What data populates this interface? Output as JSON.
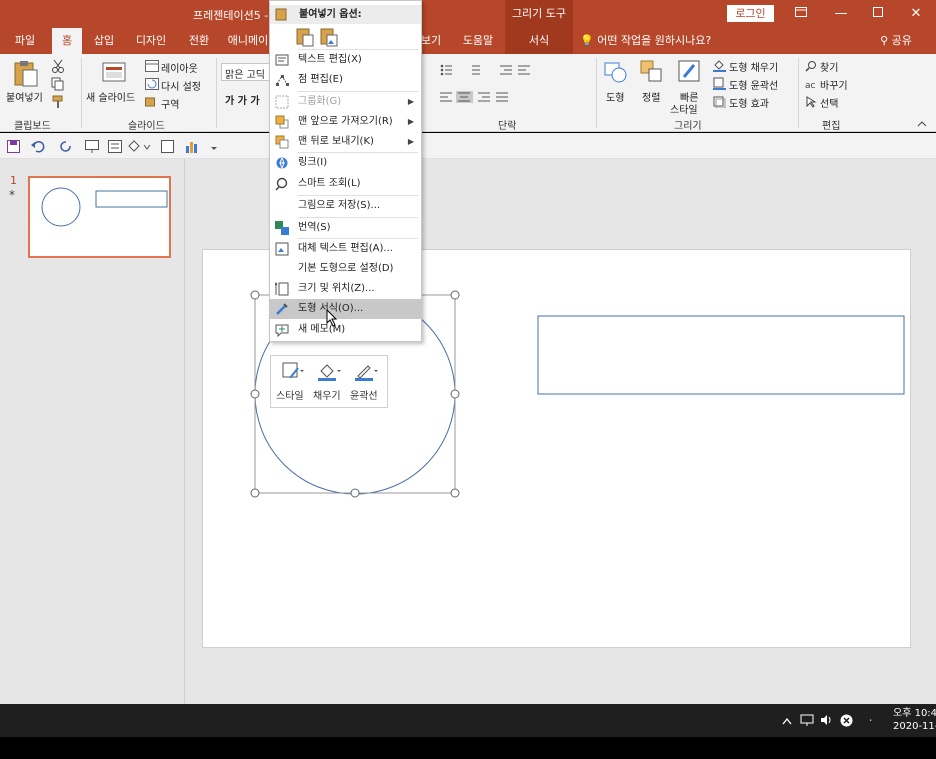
{
  "titlebar": {
    "title": "프레젠테이션5 -",
    "context_tool": "그리기 도구",
    "login": "로그인"
  },
  "tabs": [
    {
      "label": "파일"
    },
    {
      "label": "홈"
    },
    {
      "label": "삽입"
    },
    {
      "label": "디자인"
    },
    {
      "label": "전환"
    },
    {
      "label": "애니메이"
    },
    {
      "label": "보기"
    },
    {
      "label": "도움말"
    },
    {
      "label": "서식"
    }
  ],
  "tellme": "어떤 작업을 원하시나요?",
  "share": "공유",
  "ribbon": {
    "paste": "붙여넣기",
    "new_slide": "새 슬라이드",
    "layout": "레이아웃",
    "reset": "다시 설정",
    "section": "구역",
    "font_name": "맑은 고딕",
    "bold_italic": "가  가  가",
    "shape": "도형",
    "arrange": "정렬",
    "quick_styles_1": "빠른",
    "quick_styles_2": "스타일",
    "shape_fill": "도형 채우기",
    "shape_outline": "도형 윤곽선",
    "shape_effects": "도형 효과",
    "find": "찾기",
    "replace": "바꾸기",
    "select": "선택",
    "groups": {
      "clipboard": "클립보드",
      "slides": "슬라이드",
      "paragraph": "단락",
      "drawing": "그리기",
      "editing": "편집"
    }
  },
  "thumbnail": {
    "number": "1",
    "star": "*"
  },
  "context_menu": {
    "header": "붙여넣기 옵션:",
    "items": [
      {
        "label": "텍스트 편집(X)",
        "disabled": false,
        "submenu": false
      },
      {
        "label": "점 편집(E)",
        "disabled": false,
        "submenu": false
      },
      {
        "label": "그룹화(G)",
        "disabled": true,
        "submenu": true
      },
      {
        "label": "맨 앞으로 가져오기(R)",
        "disabled": false,
        "submenu": true
      },
      {
        "label": "맨 뒤로 보내기(K)",
        "disabled": false,
        "submenu": true
      },
      {
        "label": "링크(I)",
        "disabled": false,
        "submenu": false
      },
      {
        "label": "스마트 조회(L)",
        "disabled": false,
        "submenu": false
      },
      {
        "label": "그림으로 저장(S)...",
        "disabled": false,
        "submenu": false
      },
      {
        "label": "번역(S)",
        "disabled": false,
        "submenu": false
      },
      {
        "label": "대체 텍스트 편집(A)...",
        "disabled": false,
        "submenu": false
      },
      {
        "label": "기본 도형으로 설정(D)",
        "disabled": false,
        "submenu": false
      },
      {
        "label": "크기 및 위치(Z)...",
        "disabled": false,
        "submenu": false
      },
      {
        "label": "도형 서식(O)...",
        "disabled": false,
        "submenu": false,
        "highlighted": true
      },
      {
        "label": "새 메모(M)",
        "disabled": false,
        "submenu": false
      }
    ]
  },
  "mini_toolbar": {
    "style": "스타일",
    "fill": "채우기",
    "outline": "윤곽선"
  },
  "taskbar": {
    "time": "오후 10:4",
    "date": "2020-11-"
  },
  "colors": {
    "accent": "#b7472a",
    "shape_stroke": "#4a6fa5",
    "menu_highlight": "#c8c8c8"
  }
}
